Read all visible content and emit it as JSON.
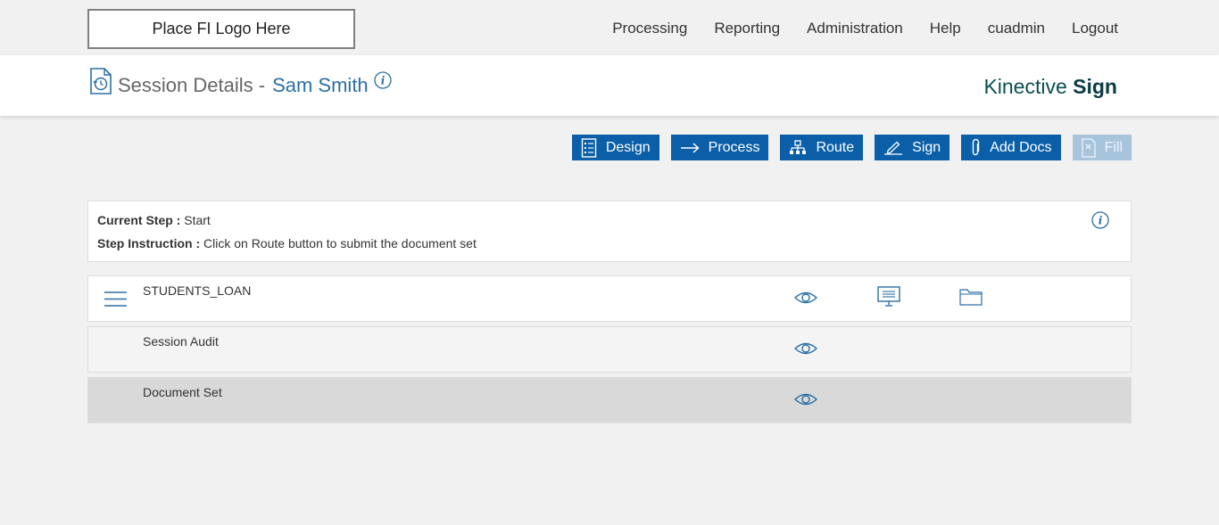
{
  "topbar": {
    "logo_text": "Place FI Logo Here",
    "nav": [
      "Processing",
      "Reporting",
      "Administration",
      "Help",
      "cuadmin",
      "Logout"
    ]
  },
  "header": {
    "title_prefix": "Session Details -",
    "title_name": "Sam Smith",
    "brand_light": "Kinective ",
    "brand_bold": "Sign"
  },
  "toolbar": {
    "buttons": [
      {
        "label": "Design",
        "icon": "list-doc-icon"
      },
      {
        "label": "Process",
        "icon": "arrow-right-icon"
      },
      {
        "label": "Route",
        "icon": "org-chart-icon"
      },
      {
        "label": "Sign",
        "icon": "pen-icon"
      },
      {
        "label": "Add Docs",
        "icon": "paperclip-icon"
      },
      {
        "label": "Fill",
        "icon": "doc-x-icon",
        "disabled": true
      }
    ]
  },
  "step": {
    "current_label": "Current Step :",
    "current_value": " Start",
    "instruction_label": "Step Instruction :",
    "instruction_value": " Click on Route button to submit the document set"
  },
  "rows": [
    {
      "label": "STUDENTS_LOAN",
      "icons": [
        "menu-icon",
        "eye-icon",
        "monitor-icon",
        "folder-icon"
      ]
    },
    {
      "label": "Session Audit",
      "icons": [
        "eye-icon"
      ]
    },
    {
      "label": "Document Set",
      "icons": [
        "eye-icon"
      ]
    }
  ],
  "colors": {
    "primary": "#0a5fa8",
    "disabled": "#a7c4dd",
    "accent_text": "#2a6fa5",
    "page_bg": "#f1f1f1",
    "row_selected": "#d9d9d9"
  }
}
